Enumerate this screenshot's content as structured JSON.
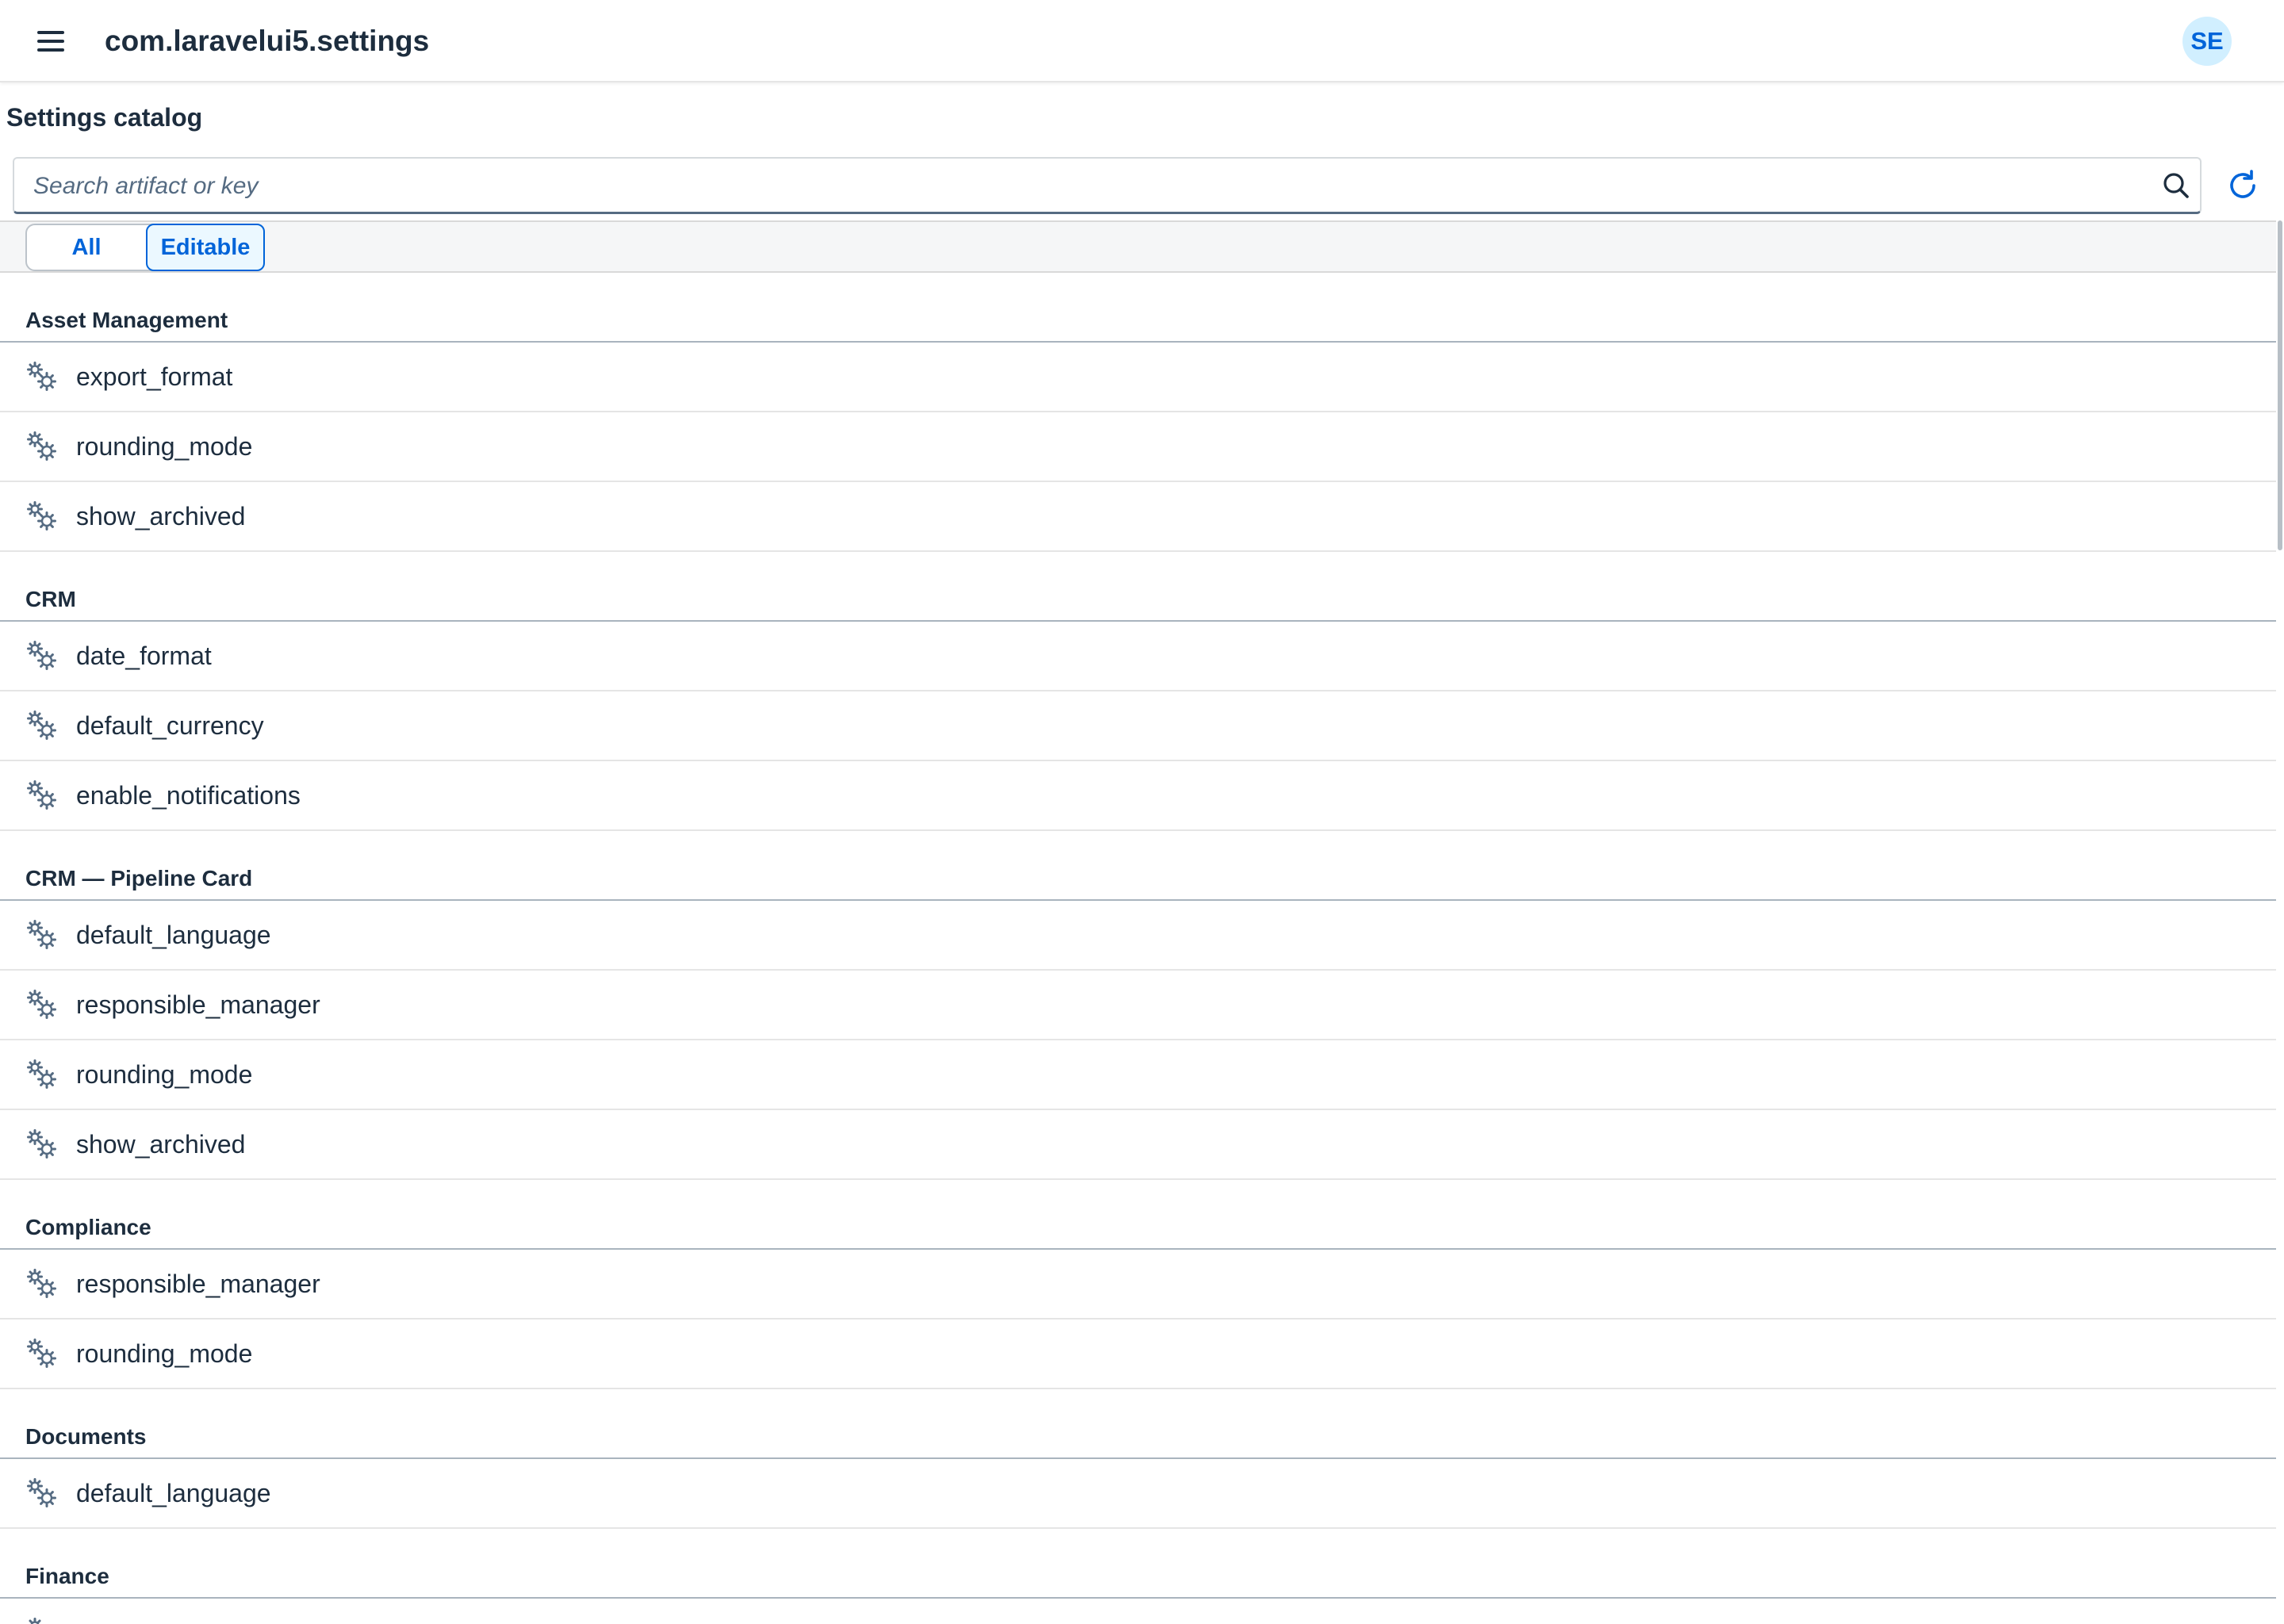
{
  "shell": {
    "app_title": "com.laravelui5.settings",
    "avatar_initials": "SE",
    "menu_icon": "hamburger-menu-icon"
  },
  "page": {
    "title": "Settings catalog"
  },
  "search": {
    "placeholder": "Search artifact or key",
    "value": "",
    "icon": "search-icon",
    "refresh_icon": "refresh-icon"
  },
  "filter": {
    "options": [
      "All",
      "Editable"
    ],
    "selected": "Editable"
  },
  "colors": {
    "accent": "#0064d9",
    "avatar_bg": "#d1efff",
    "text": "#1d2d3e",
    "icon_gray": "#556b82"
  },
  "groups": [
    {
      "title": "Asset Management",
      "items": [
        "export_format",
        "rounding_mode",
        "show_archived"
      ]
    },
    {
      "title": "CRM",
      "items": [
        "date_format",
        "default_currency",
        "enable_notifications"
      ]
    },
    {
      "title": "CRM — Pipeline Card",
      "items": [
        "default_language",
        "responsible_manager",
        "rounding_mode",
        "show_archived"
      ]
    },
    {
      "title": "Compliance",
      "items": [
        "responsible_manager",
        "rounding_mode"
      ]
    },
    {
      "title": "Documents",
      "items": [
        "default_language"
      ]
    },
    {
      "title": "Finance",
      "items": [
        ""
      ]
    }
  ],
  "item_icon": "gears-icon"
}
